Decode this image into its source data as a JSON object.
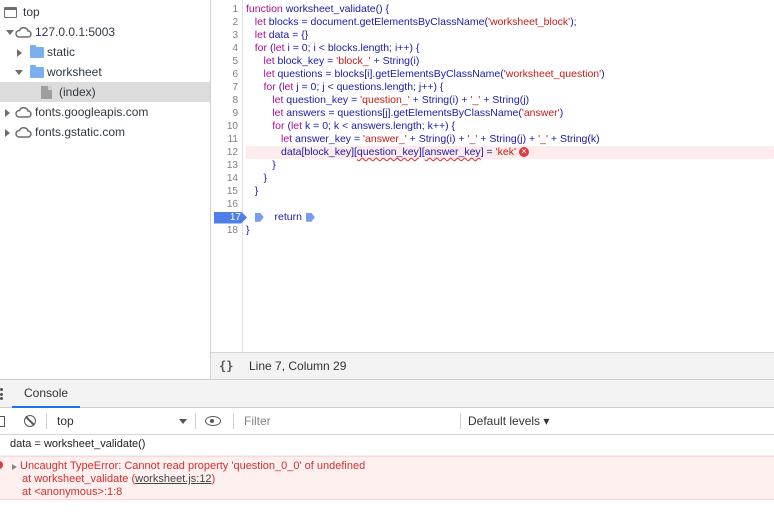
{
  "navigator": {
    "items": [
      {
        "label": "top",
        "kind": "frame"
      },
      {
        "label": "127.0.0.1:5003",
        "kind": "origin"
      },
      {
        "label": "static",
        "kind": "folder"
      },
      {
        "label": "worksheet",
        "kind": "folder"
      },
      {
        "label": "(index)",
        "kind": "file",
        "selected": true
      },
      {
        "label": "fonts.googleapis.com",
        "kind": "origin"
      },
      {
        "label": "fonts.gstatic.com",
        "kind": "origin"
      }
    ]
  },
  "editor": {
    "line_numbers": [
      "1",
      "2",
      "3",
      "4",
      "5",
      "6",
      "7",
      "8",
      "9",
      "10",
      "11",
      "12",
      "13",
      "14",
      "15",
      "16",
      "17",
      "18"
    ],
    "paused_line": "17",
    "error_line": "12",
    "lines": [
      "function worksheet_validate() {",
      "   let blocks = document.getElementsByClassName('worksheet_block');",
      "   let data = {}",
      "   for (let i = 0; i < blocks.length; i++) {",
      "      let block_key = 'block_' + String(i)",
      "      let questions = blocks[i].getElementsByClassName('worksheet_question')",
      "      for (let j = 0; j < questions.length; j++) {",
      "         let question_key = 'question_' + String(i) + '_' + String(j)",
      "         let answers = questions[j].getElementsByClassName('answer')",
      "         for (let k = 0; k < answers.length; k++) {",
      "            let answer_key = 'answer_' + String(i) + '_' + String(j) + '_' + String(k)",
      "            data[block_key][question_key][answer_key] = 'kek'",
      "         }",
      "      }",
      "   }",
      "",
      "   return data",
      "}"
    ]
  },
  "status_bar": {
    "braces": "{}",
    "position": "Line 7, Column 29"
  },
  "drawer": {
    "tab": "Console"
  },
  "console_toolbar": {
    "context": "top",
    "filter_placeholder": "Filter",
    "levels": "Default levels ▾"
  },
  "console": {
    "command": "data = worksheet_validate()",
    "error_message": "Uncaught TypeError: Cannot read property 'question_0_0' of undefined",
    "stack_prefix_1": "at worksheet_validate (",
    "stack_link": "worksheet.js:12",
    "stack_suffix_1": ")",
    "stack_2": "at <anonymous>:1:8"
  },
  "colors": {
    "keyword": "#aa0d91",
    "string": "#c41a16",
    "plain": "#1a1aa6",
    "error": "#d32f2f",
    "accent": "#1a73e8"
  }
}
